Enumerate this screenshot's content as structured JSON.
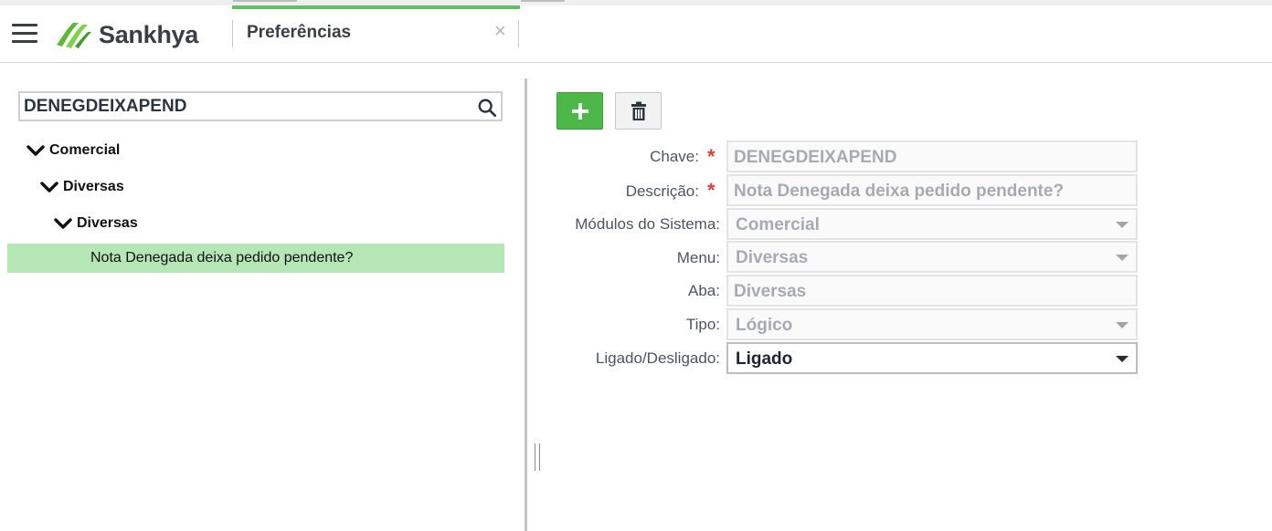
{
  "app": {
    "logo_text": "Sankhya",
    "tab_title": "Preferências",
    "tab_close": "×"
  },
  "search": {
    "value": "DENEGDEIXAPEND"
  },
  "tree": {
    "level1": "Comercial",
    "level2": "Diversas",
    "level3": "Diversas",
    "leaf": "Nota Denegada deixa pedido pendente?"
  },
  "form": {
    "chave_label": "Chave:",
    "chave_value": "DENEGDEIXAPEND",
    "descricao_label": "Descrição:",
    "descricao_value": "Nota Denegada deixa pedido pendente?",
    "modulos_label": "Módulos do Sistema:",
    "modulos_value": "Comercial",
    "menu_label": "Menu:",
    "menu_value": "Diversas",
    "aba_label": "Aba:",
    "aba_value": "Diversas",
    "tipo_label": "Tipo:",
    "tipo_value": "Lógico",
    "ligado_label": "Ligado/Desligado:",
    "ligado_value": "Ligado",
    "required_mark": "*"
  },
  "colors": {
    "accent": "#5ec05e",
    "add_button": "#4cb848",
    "selected_row": "#b5e6b5",
    "required": "#d8413a"
  },
  "icons": {
    "menu": "hamburger-icon",
    "logo": "sankhya-logo-icon",
    "search": "search-icon",
    "add": "plus-icon",
    "delete": "trash-icon",
    "expand": "chevron-down-icon",
    "dropdown": "caret-down-icon",
    "close": "close-icon"
  }
}
